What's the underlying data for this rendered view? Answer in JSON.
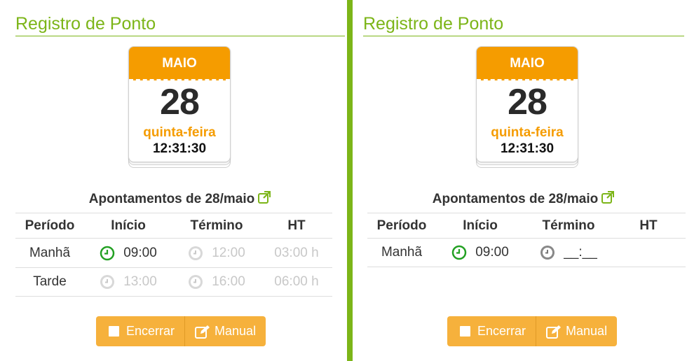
{
  "colors": {
    "accent_green": "#7cb518",
    "calendar_orange": "#f59c00",
    "button_orange": "#f6b13c",
    "clock_active": "#22a022",
    "muted": "#c8c8c8"
  },
  "panels": [
    {
      "title": "Registro de Ponto",
      "calendar": {
        "month": "MAIO",
        "day": "28",
        "weekday": "quinta-feira",
        "time": "12:31:30"
      },
      "apontamentos_title": "Apontamentos de 28/maio",
      "headers": [
        "Período",
        "Início",
        "Término",
        "HT"
      ],
      "rows": [
        {
          "periodo": "Manhã",
          "inicio": "09:00",
          "termino": "12:00",
          "ht": "03:00 h"
        },
        {
          "periodo": "Tarde",
          "inicio": "13:00",
          "termino": "16:00",
          "ht": "06:00 h"
        }
      ],
      "buttons": {
        "encerrar": "Encerrar",
        "manual": "Manual"
      }
    },
    {
      "title": "Registro de Ponto",
      "calendar": {
        "month": "MAIO",
        "day": "28",
        "weekday": "quinta-feira",
        "time": "12:31:30"
      },
      "apontamentos_title": "Apontamentos de 28/maio",
      "headers": [
        "Período",
        "Início",
        "Término",
        "HT"
      ],
      "rows": [
        {
          "periodo": "Manhã",
          "inicio": "09:00",
          "termino": "__:__",
          "ht": ""
        }
      ],
      "buttons": {
        "encerrar": "Encerrar",
        "manual": "Manual"
      }
    }
  ],
  "icons": {
    "clock": "clock-icon",
    "external": "external-link-icon",
    "checkbox": "checkbox-icon",
    "edit": "pencil-square-icon"
  }
}
